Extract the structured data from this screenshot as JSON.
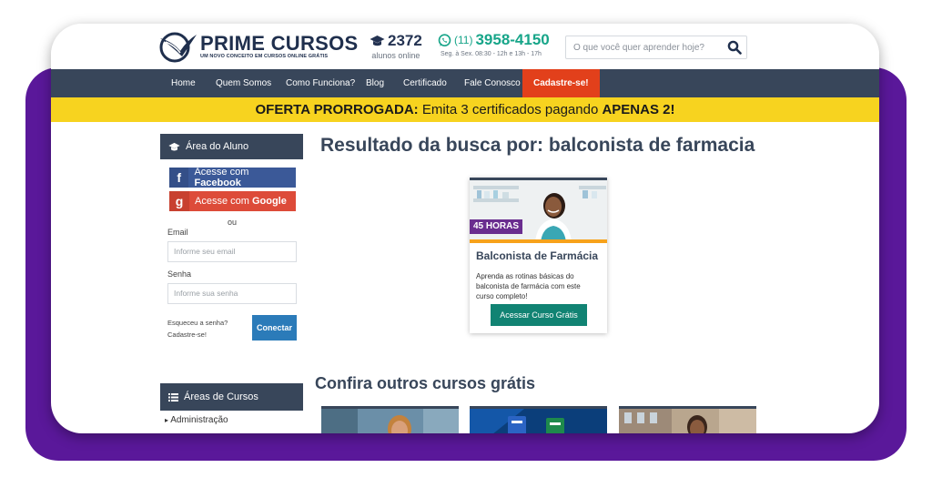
{
  "header": {
    "logo_title": "PRIME CURSOS",
    "logo_subtitle": "UM NOVO CONCEITO EM CURSOS ONLINE GRÁTIS",
    "online_count": "2372",
    "online_label": "alunos online",
    "phone_ddd": "(11)",
    "phone_number": "3958-4150",
    "phone_hours": "Seg. à Sex. 08:30 - 12h e 13h - 17h",
    "search_placeholder": "O que você quer aprender hoje?"
  },
  "nav": {
    "items": [
      "Home",
      "Quem Somos",
      "Como Funciona?",
      "Blog",
      "Certificado",
      "Fale Conosco"
    ],
    "cta": "Cadastre-se!"
  },
  "offer": {
    "lead": "OFERTA PRORROGADA:",
    "middle": " Emita 3 certificados pagando ",
    "strong": "APENAS 2!"
  },
  "sidebar": {
    "area_aluno_title": "Área do Aluno",
    "facebook_prefix": "Acesse com ",
    "facebook_strong": "Facebook",
    "google_prefix": "Acesse com ",
    "google_strong": "Google",
    "or_label": "ou",
    "email_label": "Email",
    "email_placeholder": "Informe seu email",
    "password_label": "Senha",
    "password_placeholder": "Informe sua senha",
    "forgot_link": "Esqueceu a senha?",
    "signup_link": "Cadastre-se!",
    "connect_button": "Conectar",
    "areas_title": "Áreas de Cursos",
    "areas_items": [
      "Administração"
    ]
  },
  "main": {
    "results_title": "Resultado da busca por: balconista de farmacia",
    "course": {
      "badge": "45 HORAS",
      "title": "Balconista de Farmácia",
      "description": "Aprenda as rotinas básicas do balconista de farmácia com este curso completo!",
      "button": "Acessar Curso Grátis"
    },
    "others_title": "Confira outros cursos grátis"
  },
  "colors": {
    "purple_back": "#5a189a",
    "nav_bg": "#38465a",
    "cta": "#e2401b",
    "offer_bg": "#f7d31f",
    "course_button": "#118373",
    "phone_green": "#17a589"
  }
}
